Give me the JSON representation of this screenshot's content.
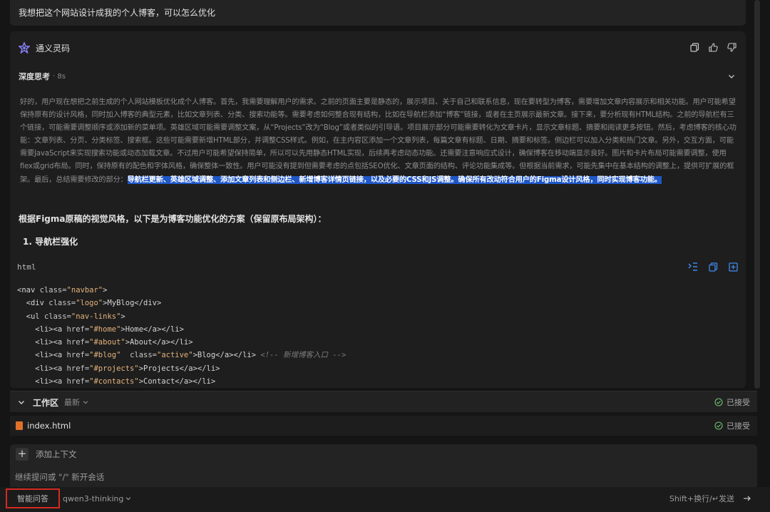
{
  "user_message": "我想把这个网站设计成我的个人博客，可以怎么优化",
  "assistant": {
    "name": "通义灵码",
    "icons": [
      "copy-icon",
      "thumbs-up-icon",
      "thumbs-down-icon"
    ],
    "deep_think": {
      "label": "深度思考",
      "time": "· 8s",
      "text": "好的，用户现在想把之前生成的个人网站模板优化成个人博客。首先，我需要理解用户的需求。之前的页面主要是静态的，展示项目、关于自己和联系信息，现在要转型为博客，需要增加文章内容展示和相关功能。用户可能希望保持原有的设计风格，同时加入博客的典型元素，比如文章列表、分类、搜索功能等。需要考虑如何整合现有结构，比如在导航栏添加“博客”链接，或者在主页展示最新文章。接下来，要分析现有HTML结构。之前的导航栏有三个链接，可能需要调整顺序或添加新的菜单项。英雄区域可能需要调整文案，从“Projects”改为“Blog”或者类似的引导语。项目展示部分可能需要转化为文章卡片，显示文章标题、摘要和阅读更多按钮。然后，考虑博客的核心功能：文章列表、分页、分类标签、搜索框。这些可能需要新增HTML部分，并调整CSS样式。例如，在主内容区添加一个文章列表，每篇文章有标题、日期、摘要和标签。侧边栏可以加入分类和热门文章。另外，交互方面，可能需要JavaScript来实现搜索功能或动态加载文章。不过用户可能希望保持简单，所以可以先用静态HTML实现，后续再考虑动态功能。还需要注意响应式设计，确保博客在移动端显示良好。图片和卡片布局可能需要调整，使用flex或grid布局。同时，保持原有的配色和字体风格，确保整体一致性。用户可能没有提到但需要考虑的点包括SEO优化、文章页面的结构、评论功能集成等。但根据当前需求，可能先集中在基本结构的调整上，提供可扩展的框架。最后，总结需要修改的部分：",
      "highlight": "导航栏更新、英雄区域调整、添加文章列表和侧边栏、新增博客详情页链接，以及必要的CSS和JS调整。确保所有改动符合用户的Figma设计风格，同时实现博客功能。"
    },
    "answer_intro": "根据Figma原稿的视觉风格，以下是为博客功能优化的方案（保留原布局架构）：",
    "section_title": "1. 导航栏强化",
    "code": {
      "lang": "html",
      "lines": [
        [
          [
            "tag",
            "<nav "
          ],
          [
            "attr",
            "class="
          ],
          [
            "str",
            "\"navbar\""
          ],
          [
            "tag",
            ">"
          ]
        ],
        [
          [
            "tag",
            "  <div "
          ],
          [
            "attr",
            "class="
          ],
          [
            "str",
            "\"logo\""
          ],
          [
            "tag",
            ">MyBlog</div>"
          ]
        ],
        [
          [
            "tag",
            "  <ul "
          ],
          [
            "attr",
            "class="
          ],
          [
            "str",
            "\"nav-links\""
          ],
          [
            "tag",
            ">"
          ]
        ],
        [
          [
            "tag",
            "    <li><a "
          ],
          [
            "attr",
            "href="
          ],
          [
            "str",
            "\"#home\""
          ],
          [
            "tag",
            ">Home</a></li>"
          ]
        ],
        [
          [
            "tag",
            "    <li><a "
          ],
          [
            "attr",
            "href="
          ],
          [
            "str",
            "\"#about\""
          ],
          [
            "tag",
            ">About</a></li>"
          ]
        ],
        [
          [
            "tag",
            "    <li><a "
          ],
          [
            "attr",
            "href="
          ],
          [
            "str",
            "\"#blog\""
          ],
          [
            "attr",
            "  class="
          ],
          [
            "str",
            "\"active\""
          ],
          [
            "tag",
            ">Blog</a></li> "
          ],
          [
            "cm",
            "<!-- 新增博客入口 -->"
          ]
        ],
        [
          [
            "tag",
            "    <li><a "
          ],
          [
            "attr",
            "href="
          ],
          [
            "str",
            "\"#projects\""
          ],
          [
            "tag",
            ">Projects</a></li>"
          ]
        ],
        [
          [
            "tag",
            "    <li><a "
          ],
          [
            "attr",
            "href="
          ],
          [
            "str",
            "\"#contacts\""
          ],
          [
            "tag",
            ">Contact</a></li>"
          ]
        ]
      ]
    }
  },
  "workspace": {
    "title": "工作区",
    "recent": "最新",
    "accepted": "已接受",
    "file": "index.html",
    "file_status": "已接受"
  },
  "input": {
    "add_context": "添加上下文",
    "placeholder": "继续提问或 \"/\" 新开会话"
  },
  "bottom": {
    "mode": "智能问答",
    "model": "qwen3-thinking",
    "hint": "Shift+换行/↵发送"
  }
}
